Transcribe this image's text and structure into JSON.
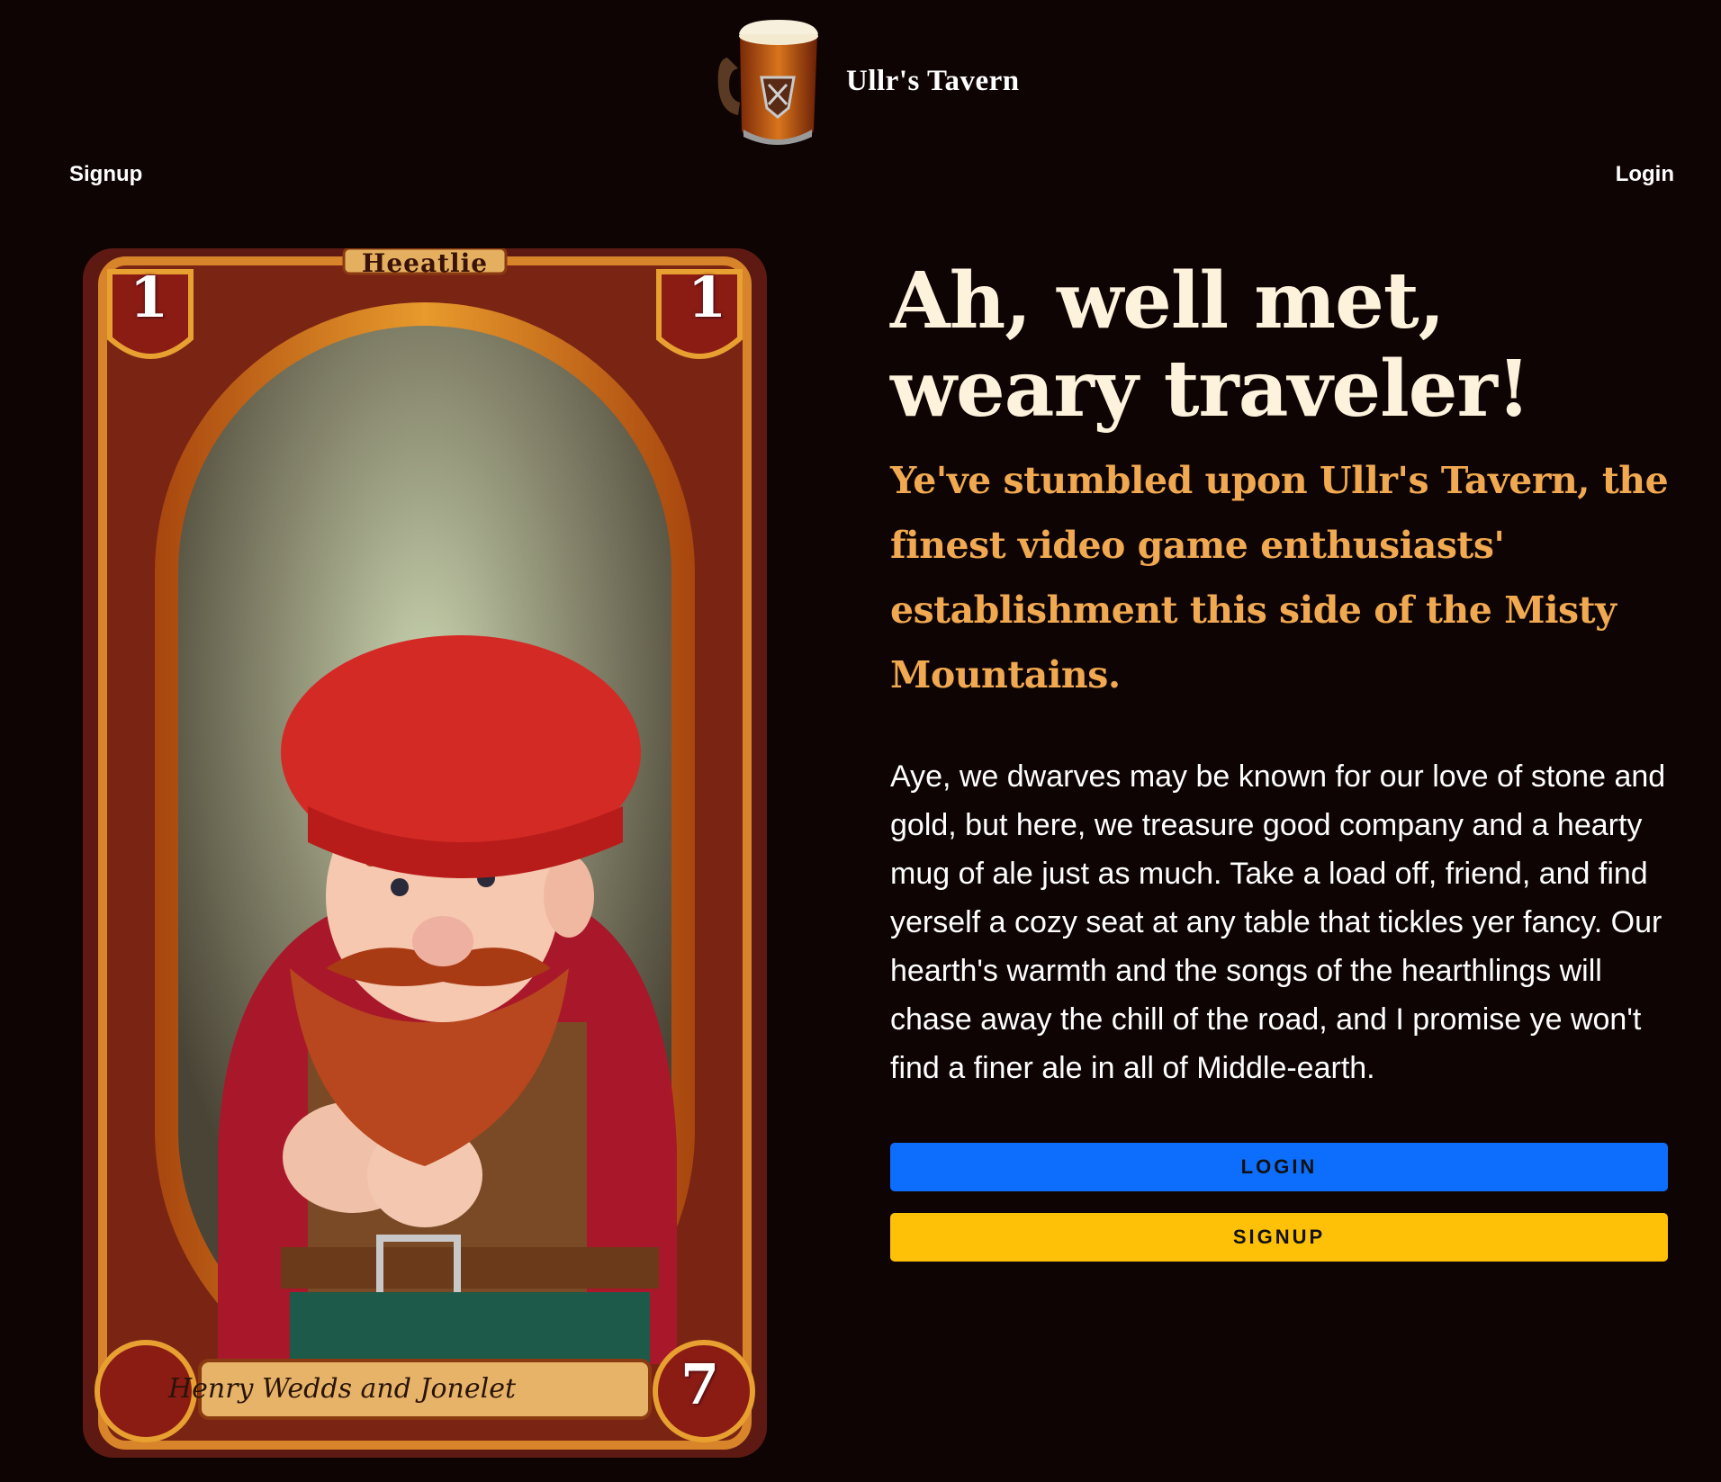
{
  "header": {
    "brand_name": "Ullr's Tavern",
    "logo_icon": "beer-mug-icon"
  },
  "nav": {
    "signup_label": "Signup",
    "login_label": "Login"
  },
  "card": {
    "title": "Heeatlie",
    "caption": "Henry Wedds and Jonelet",
    "top_left_number": "1",
    "top_right_number": "1",
    "bottom_right_number": "7"
  },
  "hero": {
    "headline": "Ah, well met, weary traveler!",
    "subheadline": "Ye've stumbled upon Ullr's Tavern, the finest video game enthusiasts' establishment this side of the Misty Mountains.",
    "body": "Aye, we dwarves may be known for our love of stone and gold, but here, we treasure good company and a hearty mug of ale just as much. Take a load off, friend, and find yerself a cozy seat at any table that tickles yer fancy. Our hearth's warmth and the songs of the hearthlings will chase away the chill of the road, and I promise ye won't find a finer ale in all of Middle-earth.",
    "login_button": "LOGIN",
    "signup_button": "SIGNUP"
  },
  "colors": {
    "background": "#0f0404",
    "headline": "#fdf3dc",
    "subheadline": "#f0a950",
    "login_button": "#0d6efd",
    "signup_button": "#ffc107"
  }
}
